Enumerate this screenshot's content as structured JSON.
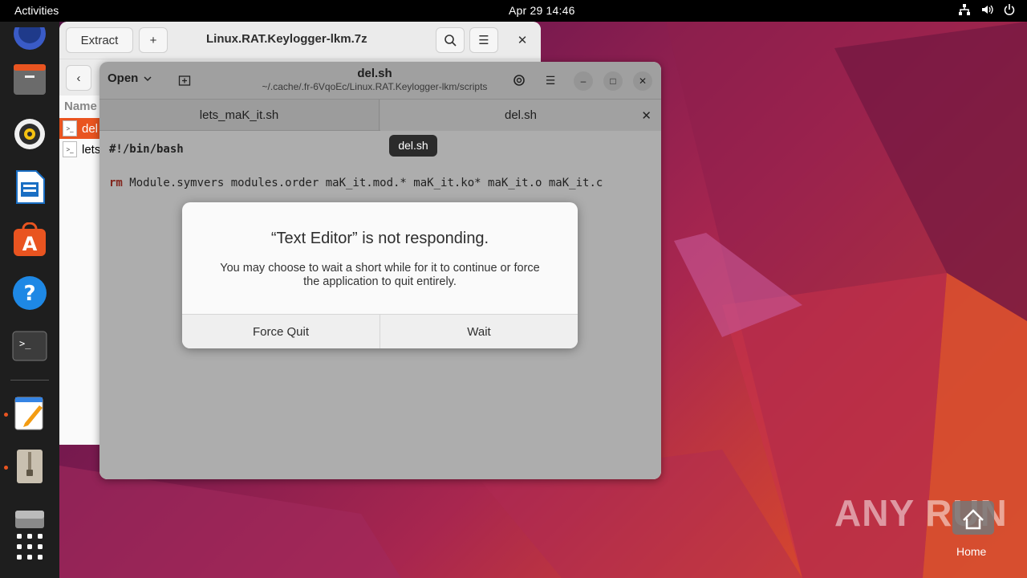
{
  "topbar": {
    "activities": "Activities",
    "clock": "Apr 29  14:46"
  },
  "dock": {
    "items": [
      "firefox-icon",
      "files-icon",
      "rhythmbox-icon",
      "libreoffice-writer-icon",
      "app-center-icon",
      "help-icon",
      "terminal-icon",
      "text-editor-icon",
      "archive-manager-icon",
      "disk-icon",
      "show-apps-icon"
    ]
  },
  "archive": {
    "extract_label": "Extract",
    "title": "Linux.RAT.Keylogger-lkm.7z",
    "column_name": "Name",
    "files": [
      {
        "name": "del"
      },
      {
        "name": "lets"
      }
    ]
  },
  "editor": {
    "open_label": "Open",
    "title": "del.sh",
    "path": "~/.cache/.fr-6VqoEc/Linux.RAT.Keylogger-lkm/scripts",
    "tabs": [
      {
        "label": "lets_maK_it.sh"
      },
      {
        "label": "del.sh"
      }
    ],
    "lines": {
      "line1": "#!/bin/bash",
      "line3_cmd": "rm",
      "line3_args": " Module.symvers modules.order maK_it.mod.* maK_it.ko* maK_it.o maK_it.c"
    }
  },
  "tooltip": {
    "text": "del.sh"
  },
  "dialog": {
    "title": "“Text Editor” is not responding.",
    "body": "You may choose to wait a short while for it to continue or force the application to quit entirely.",
    "force_quit": "Force Quit",
    "wait": "Wait"
  },
  "watermark": {
    "text": "ANY RUN"
  },
  "desktop": {
    "home_label": "Home"
  },
  "colors": {
    "accent": "#e95420",
    "topbar": "#000000",
    "dock": "#1e1e1e"
  }
}
